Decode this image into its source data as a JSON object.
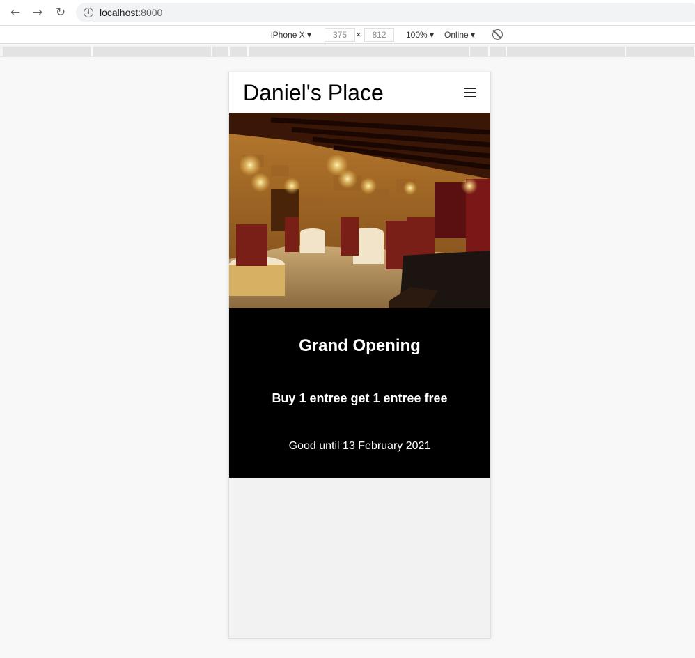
{
  "browser": {
    "url_host": "localhost",
    "url_port": ":8000",
    "icons": {
      "back": "arrow-left-icon",
      "forward": "arrow-right-icon",
      "reload": "reload-icon",
      "info": "info-icon"
    }
  },
  "device_toolbar": {
    "device": "iPhone X ▾",
    "width": "375",
    "height": "812",
    "times": "×",
    "zoom": "100% ▾",
    "throttle": "Online ▾",
    "rotate_icon": "rotate-icon"
  },
  "site": {
    "title": "Daniel's Place",
    "menu_icon": "hamburger-menu-icon",
    "hero_image": "restaurant dining room photo",
    "promo": {
      "title": "Grand Opening",
      "offer": "Buy 1 entree get 1 entree free",
      "valid": "Good until 13 February 2021"
    }
  },
  "colors": {
    "promo_background": "#000000",
    "promo_text": "#ffffff",
    "page_background": "#f2f2f2"
  }
}
